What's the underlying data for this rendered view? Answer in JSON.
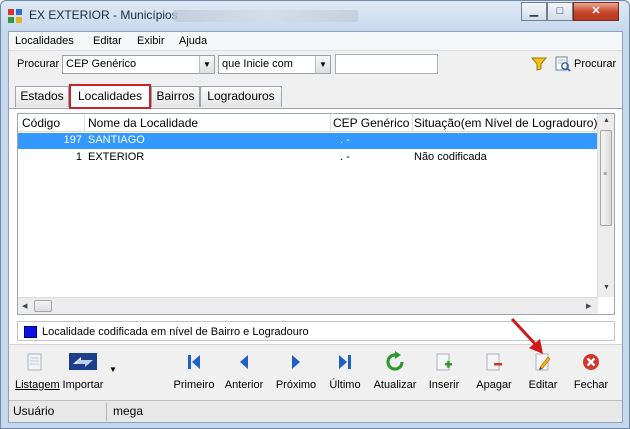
{
  "window": {
    "title": "EX EXTERIOR -  Municípios",
    "min_label": "▁",
    "max_label": "□",
    "close_label": "✕"
  },
  "menu": [
    "Localidades",
    "Editar",
    "Exibir",
    "Ajuda"
  ],
  "search": {
    "procurar_label": "Procurar",
    "field_value": "CEP Genérico",
    "mode_value": "que Inicie com",
    "text_value": "",
    "search_button_label": "Procurar"
  },
  "tabs": [
    {
      "label": "Estados",
      "active": false
    },
    {
      "label": "Localidades",
      "active": true
    },
    {
      "label": "Bairros",
      "active": false
    },
    {
      "label": "Logradouros",
      "active": false
    }
  ],
  "grid": {
    "columns": [
      "Código",
      "Nome da Localidade",
      "CEP Genérico",
      "Situação(em Nível de Logradouro)"
    ],
    "rows": [
      {
        "codigo": "197",
        "nome": "SANTIAGO",
        "cep": ".   -",
        "situacao": "",
        "selected": true
      },
      {
        "codigo": "1",
        "nome": "EXTERIOR",
        "cep": ".   -",
        "situacao": "Não codificada",
        "selected": false
      }
    ]
  },
  "legend": {
    "text": "Localidade codificada em nível de Bairro e Logradouro",
    "color": "#0b12e6"
  },
  "toolbar": [
    {
      "label": "Listagem",
      "icon": "listing-icon"
    },
    {
      "label": "Importar",
      "icon": "import-icon"
    },
    {
      "label": "Primeiro",
      "icon": "first-icon"
    },
    {
      "label": "Anterior",
      "icon": "previous-icon"
    },
    {
      "label": "Próximo",
      "icon": "next-icon"
    },
    {
      "label": "Último",
      "icon": "last-icon"
    },
    {
      "label": "Atualizar",
      "icon": "refresh-icon"
    },
    {
      "label": "Inserir",
      "icon": "insert-icon"
    },
    {
      "label": "Apagar",
      "icon": "delete-icon"
    },
    {
      "label": "Editar",
      "icon": "edit-icon"
    },
    {
      "label": "Fechar",
      "icon": "close-icon"
    }
  ],
  "status": {
    "user_label": "Usuário",
    "user_value": "mega"
  },
  "colors": {
    "selection": "#3399ff",
    "nav_blue": "#1f5fc8",
    "refresh_green": "#2e9a2e",
    "close_red": "#d6362a",
    "highlight_red": "#c8232b"
  }
}
